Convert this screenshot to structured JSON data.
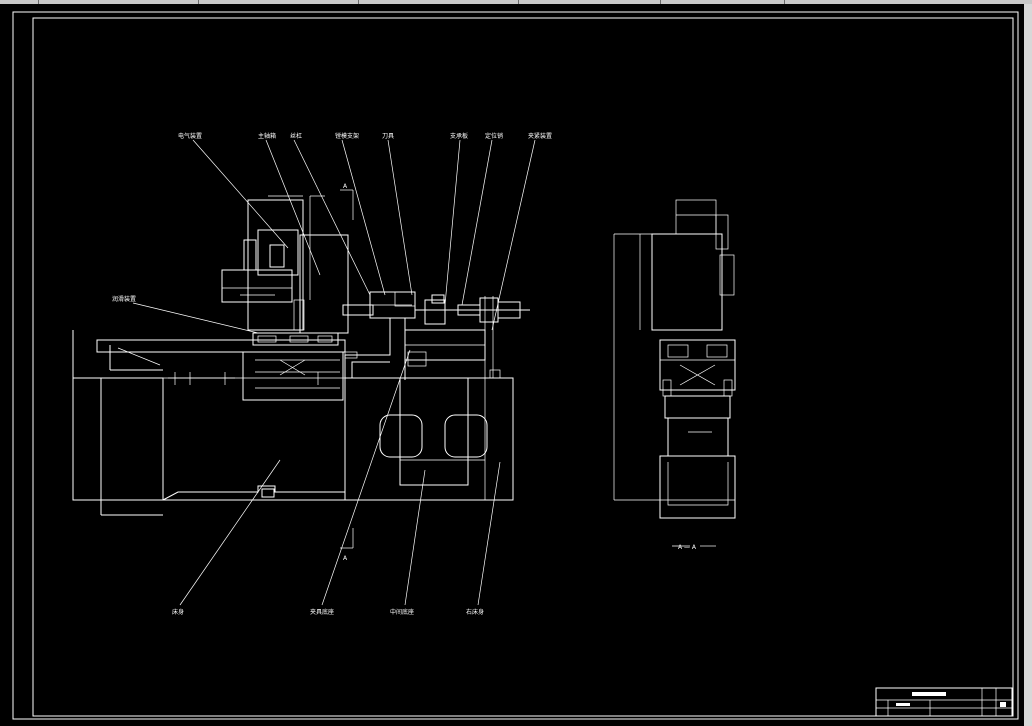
{
  "window": {
    "tabs": [
      "",
      "",
      "",
      "",
      "",
      ""
    ]
  },
  "drawing": {
    "labels": {
      "electric": "电气装置",
      "spindle_box": "主轴箱",
      "lead_screw": "丝杠",
      "guide_rail": "镗模支架",
      "cutter": "刀具",
      "bracket": "支承板",
      "locating_pin": "定位销",
      "clamp": "夹紧装置",
      "lubrication": "润滑装置",
      "bed": "床身",
      "slide_base": "夹具底座",
      "middle_base": "中间底座",
      "right_bed": "右床身"
    },
    "section_marks": {
      "a_top": "A",
      "a_bottom": "A",
      "view_label": "A — A"
    }
  }
}
